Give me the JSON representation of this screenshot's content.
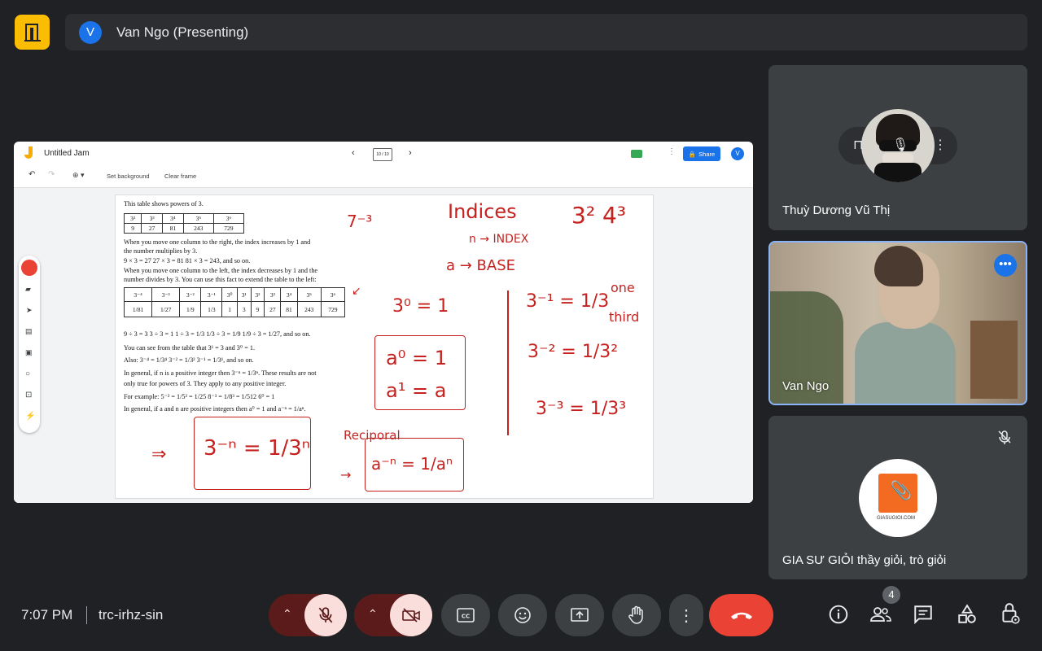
{
  "header": {
    "presenter_initial": "V",
    "presenter_label": "Van Ngo (Presenting)"
  },
  "jam": {
    "title": "Untitled Jam",
    "page_indicator": "10 / 10",
    "share_label": "Share",
    "user_initial": "V",
    "set_background": "Set background",
    "clear_frame": "Clear frame"
  },
  "page": {
    "l1": "This table shows powers of 3.",
    "t1_top": [
      "3²",
      "3³",
      "3⁴",
      "3⁵",
      "3⁶"
    ],
    "t1_bottom": [
      "9",
      "27",
      "81",
      "243",
      "729"
    ],
    "l2": "When you move one column to the right, the index increases by 1 and",
    "l3": "the number multiplies by 3.",
    "l4": "9 × 3 = 27      27 × 3 = 81      81 × 3 = 243, and so on.",
    "l5": "When you move one column to the left, the index decreases by 1 and the",
    "l6": "number divides by 3. You can use this fact to extend the table to the left:",
    "t2_top": [
      "3⁻⁴",
      "3⁻³",
      "3⁻²",
      "3⁻¹",
      "3⁰",
      "3¹",
      "3²",
      "3³",
      "3⁴",
      "3⁵",
      "3⁶"
    ],
    "t2_bottom": [
      "1/81",
      "1/27",
      "1/9",
      "1/3",
      "1",
      "3",
      "9",
      "27",
      "81",
      "243",
      "729"
    ],
    "l7": "9 ÷ 3 = 3      3 ÷ 3 = 1      1 ÷ 3 = 1/3      1/3 ÷ 3 = 1/9      1/9 ÷ 3 = 1/27, and so on.",
    "l8": "You can see from the table that 3¹ = 3 and 3⁰ = 1.",
    "l9": "Also: 3⁻⁴ = 1/3⁴      3⁻² = 1/3²      3⁻¹ = 1/3¹, and so on.",
    "l10": "In general, if n is a positive integer then 3⁻ⁿ = 1/3ⁿ. These results are not",
    "l11": "only true for powers of 3. They apply to any positive integer.",
    "l12": "For example: 5⁻² = 1/5² = 1/25      8⁻³ = 1/8³ = 1/512      6⁰ = 1",
    "l13": "In general, if a and n are positive integers then a⁰ = 1 and a⁻ⁿ = 1/aⁿ."
  },
  "handwriting": {
    "t1": "7⁻³",
    "t2": "Indices",
    "t3": "3²   4³",
    "t4": "n → INDEX",
    "t5": "a → BASE",
    "t6": "3⁰ = 1",
    "t7": "3⁻¹ = 1/3",
    "t7b": "one",
    "t7c": "third",
    "t8": "a⁰ = 1",
    "t9": "a¹ = a",
    "t10": "3⁻² = 1/3²",
    "t11": "3⁻³ = 1/3³",
    "t12": "3⁻ⁿ = 1/3ⁿ",
    "t13": "Reciporal",
    "t14": "a⁻ⁿ = 1/aⁿ"
  },
  "participants": [
    {
      "name": "Thuỳ Dương Vũ Thị"
    },
    {
      "name": "Van Ngo"
    },
    {
      "name": "GIA SƯ GIỎI thầy giỏi, trò giỏi",
      "logo_text": "GIASUGIOI.COM"
    }
  ],
  "footer": {
    "time": "7:07 PM",
    "meeting_code": "trc-irhz-sin",
    "people_count": "4"
  },
  "colors": {
    "background": "#202124",
    "tile": "#3c4043",
    "end_call": "#ea4335",
    "muted": "#f9dedc",
    "muted_dark": "#5c1b1b",
    "accent": "#1a73e8",
    "ink": "#c5221f"
  }
}
